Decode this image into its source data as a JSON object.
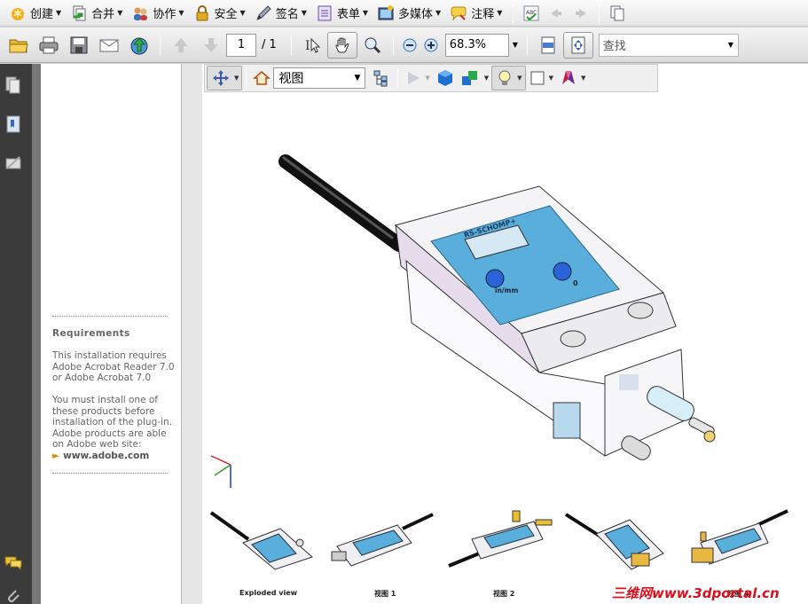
{
  "toolbar_main": {
    "items": [
      {
        "label": "创建",
        "icon": "create-icon"
      },
      {
        "label": "合并",
        "icon": "combine-icon"
      },
      {
        "label": "协作",
        "icon": "collaborate-icon"
      },
      {
        "label": "安全",
        "icon": "lock-icon"
      },
      {
        "label": "签名",
        "icon": "pen-icon"
      },
      {
        "label": "表单",
        "icon": "form-icon"
      },
      {
        "label": "多媒体",
        "icon": "multimedia-icon"
      },
      {
        "label": "注释",
        "icon": "comment-icon"
      }
    ]
  },
  "toolbar_nav": {
    "page_current": "1",
    "page_total": "/ 1",
    "zoom": "68.3%",
    "search_placeholder": "查找"
  },
  "toolbar_3d": {
    "view_selected": "视图"
  },
  "requirements": {
    "title": "Requirements",
    "p1": "This installation requires Adobe Acrobat Reader 7.0 or Adobe Acrobat 7.0",
    "p2": "You must install one of these products before installation of the plug-in. Adobe products are able on Adobe web site:",
    "link": "www.adobe.com"
  },
  "device": {
    "label_brand": "RS-SCHOMP+",
    "button_left": "in/mm",
    "button_right": "0"
  },
  "thumbnails": [
    {
      "label": "Exploded view"
    },
    {
      "label": "视图 1"
    },
    {
      "label": "视图 2"
    },
    {
      "label": ""
    },
    {
      "label": "视图 4"
    }
  ],
  "watermark": "三维网www.3dportal.cn",
  "colors": {
    "nav_bg": "#3b3b3b",
    "panel_blue": "#5aaedb",
    "accent_orange": "#e08a00"
  }
}
